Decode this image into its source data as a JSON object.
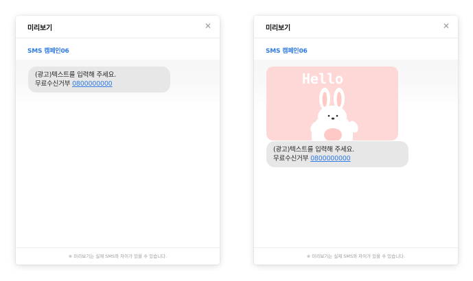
{
  "panels": [
    {
      "title": "미리보기",
      "close_icon": "close-icon",
      "campaign": "SMS 캠페인06",
      "message_line1": "(광고)텍스트를 입력해 주세요.",
      "message_line2_prefix": "무료수신거부",
      "phone": "0800000000",
      "footer": "※ 미리보기는 실제 SMS와 차이가 있을 수 있습니다."
    },
    {
      "title": "미리보기",
      "close_icon": "close-icon",
      "campaign": "SMS 캠페인06",
      "image": {
        "text": "Hello",
        "icon": "bunny-illustration",
        "background": "#fdd8d6"
      },
      "message_line1": "(광고)텍스트를 입력해 주세요.",
      "message_line2_prefix": "무료수신거부",
      "phone": "0800000000",
      "footer": "※ 미리보기는 실제 SMS와 차이가 있을 수 있습니다."
    }
  ],
  "colors": {
    "accent": "#2f7be6",
    "bubble": "#e7e7e7",
    "image_bg": "#fdd8d6"
  }
}
